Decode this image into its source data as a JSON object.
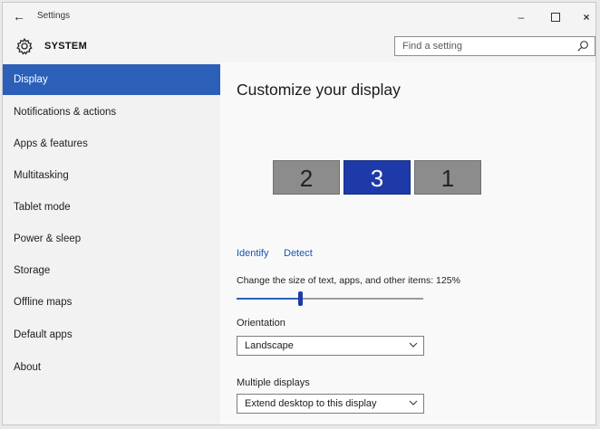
{
  "window": {
    "title": "Settings",
    "back_glyph": "←",
    "min_glyph": "–",
    "close_glyph": "×"
  },
  "header": {
    "section": "SYSTEM",
    "section_icon": "gear-icon",
    "search_placeholder": "Find a setting",
    "search_icon": "search-icon"
  },
  "sidebar": {
    "items": [
      {
        "label": "Display",
        "selected": true
      },
      {
        "label": "Notifications & actions"
      },
      {
        "label": "Apps & features"
      },
      {
        "label": "Multitasking"
      },
      {
        "label": "Tablet mode"
      },
      {
        "label": "Power & sleep"
      },
      {
        "label": "Storage"
      },
      {
        "label": "Offline maps"
      },
      {
        "label": "Default apps"
      },
      {
        "label": "About"
      }
    ]
  },
  "main": {
    "title": "Customize your display",
    "monitors": [
      {
        "label": "2",
        "active": false
      },
      {
        "label": "3",
        "active": true
      },
      {
        "label": "1",
        "active": false
      }
    ],
    "identify_link": "Identify",
    "detect_link": "Detect",
    "scale_label": "Change the size of text, apps, and other items: 125%",
    "scale_slider_level": 0.34,
    "orientation_label": "Orientation",
    "orientation_value": "Landscape",
    "multiple_displays_label": "Multiple displays",
    "multiple_displays_value": "Extend desktop to this display"
  },
  "colors": {
    "accent": "#2c60b8",
    "active_monitor": "#1e3aa8",
    "inactive_monitor": "#8c8c8c",
    "link": "#1756b5"
  }
}
